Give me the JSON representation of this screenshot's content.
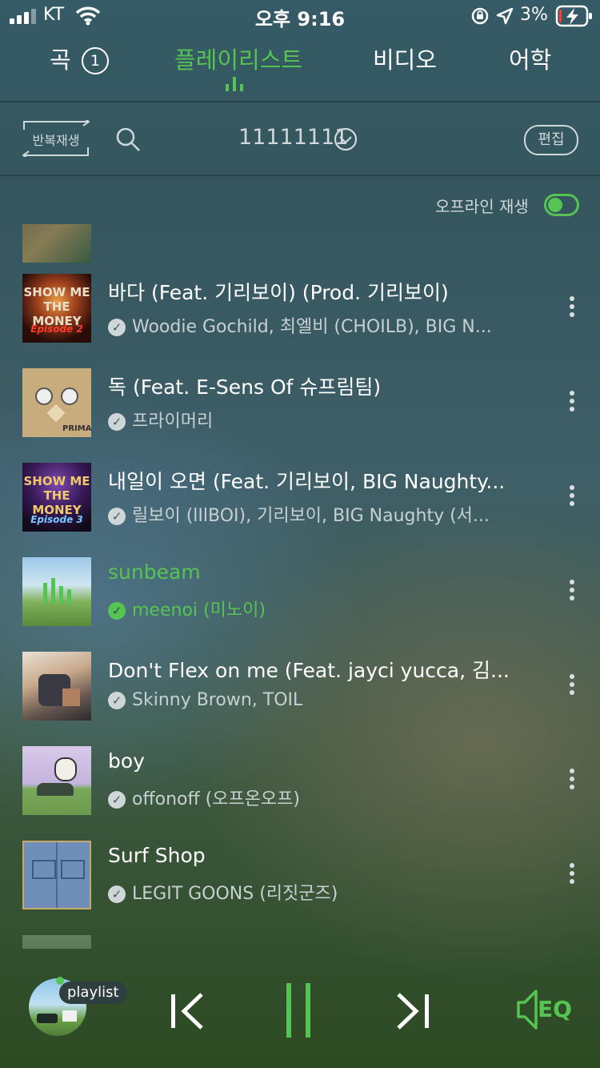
{
  "status": {
    "carrier": "KT",
    "time": "오후 9:16",
    "battery": "3%"
  },
  "tabs": {
    "songs": "곡",
    "song_count": "1",
    "playlist": "플레이리스트",
    "video": "비디오",
    "language": "어학"
  },
  "toolbar": {
    "repeat": "반복재생",
    "playlist_name": "11111111",
    "edit": "편집"
  },
  "offline": {
    "label": "오프라인 재생",
    "enabled": true
  },
  "tracks": [
    {
      "title": "바다 (Feat. 기리보이) (Prod. 기리보이)",
      "artist": "Woodie Gochild, 최엘비 (CHOILB), BIG N...",
      "art_label": "Episode 2"
    },
    {
      "title": "독 (Feat. E-Sens Of 슈프림팀)",
      "artist": "프라이머리",
      "art_label": "PRIMARY"
    },
    {
      "title": "내일이 오면 (Feat. 기리보이, BIG Naughty...",
      "artist": "릴보이 (lIlBOI), 기리보이, BIG Naughty (서...",
      "art_label": "Episode 3"
    },
    {
      "title": "sunbeam",
      "artist": "meenoi (미노이)",
      "playing": true
    },
    {
      "title": "Don't Flex on me (Feat. jayci yucca, 김...",
      "artist": "Skinny Brown, TOIL"
    },
    {
      "title": "boy",
      "artist": "offonoff (오프온오프)"
    },
    {
      "title": "Surf Shop",
      "artist": "LEGIT GOONS (리짓군즈)"
    }
  ],
  "player": {
    "badge": "playlist",
    "eq": "EQ"
  },
  "colors": {
    "accent": "#55c453"
  }
}
